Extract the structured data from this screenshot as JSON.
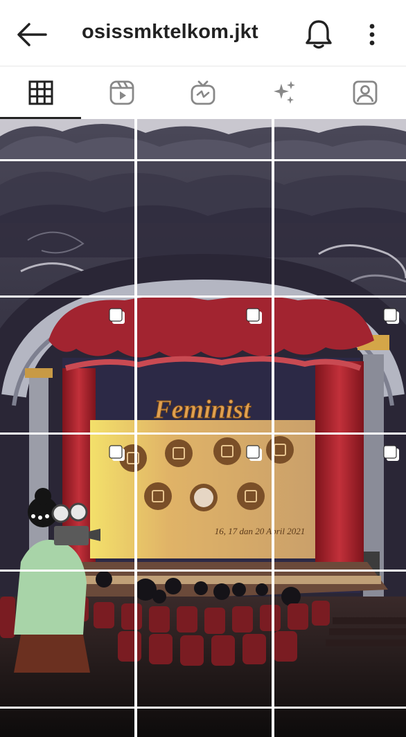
{
  "header": {
    "title": "osissmktelkom.jkt",
    "icons": {
      "back": "back-arrow-icon",
      "notifications": "bell-icon",
      "more": "more-vertical-icon"
    }
  },
  "tabs": [
    {
      "icon": "grid-icon",
      "active": true
    },
    {
      "icon": "reels-icon",
      "active": false
    },
    {
      "icon": "igtv-icon",
      "active": false
    },
    {
      "icon": "sparkles-icon",
      "active": false
    },
    {
      "icon": "tagged-person-icon",
      "active": false
    }
  ],
  "mosaic": {
    "banner_title": "Feminist",
    "banner_dates": "16, 17 dan 20 April 2021"
  },
  "colors": {
    "sky": "#3a3748",
    "curtain": "#a3202a",
    "screen": "#d8a560",
    "blouse": "#a8d4a8",
    "seats": "#7a1c22"
  }
}
